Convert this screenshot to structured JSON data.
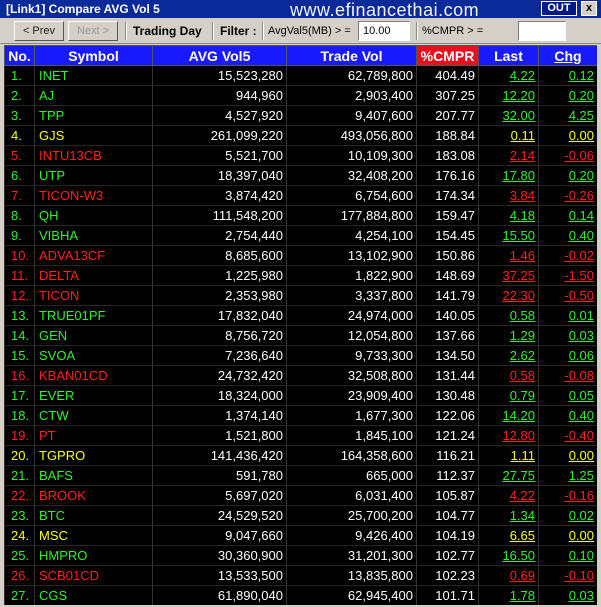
{
  "window": {
    "title": "[Link1] Compare AVG Vol 5",
    "out_label": "OUT",
    "close_label": "x",
    "watermark": "www.efinancethai.com"
  },
  "toolbar": {
    "prev_label": "< Prev",
    "next_label": "Next >",
    "mode_label": "Trading Day",
    "filter_label": "Filter :",
    "avg_filter_label": "AvgVal5(MB) > =",
    "avg_filter_value": "10.00",
    "cmpr_filter_label": "%CMPR > =",
    "cmpr_filter_value": ""
  },
  "table": {
    "headers": {
      "no": "No.",
      "symbol": "Symbol",
      "avg": "AVG Vol5",
      "trade": "Trade Vol",
      "cmpr": "%CMPR",
      "last": "Last",
      "chg": "Chg"
    },
    "colors": {
      "green": "#2ef22e",
      "red": "#ff2020",
      "yellow": "#ffff00",
      "header_blue": "#1a1aff",
      "header_red": "#e8101e"
    },
    "rows": [
      {
        "no": "1.",
        "symbol": "INET",
        "avg": "15,523,280",
        "trade": "62,789,800",
        "cmpr": "404.49",
        "last": "4.22",
        "chg": "0.12",
        "c": "g"
      },
      {
        "no": "2.",
        "symbol": "AJ",
        "avg": "944,960",
        "trade": "2,903,400",
        "cmpr": "307.25",
        "last": "12.20",
        "chg": "0.20",
        "c": "g"
      },
      {
        "no": "3.",
        "symbol": "TPP",
        "avg": "4,527,920",
        "trade": "9,407,600",
        "cmpr": "207.77",
        "last": "32.00",
        "chg": "4.25",
        "c": "g"
      },
      {
        "no": "4.",
        "symbol": "GJS",
        "avg": "261,099,220",
        "trade": "493,056,800",
        "cmpr": "188.84",
        "last": "0.11",
        "chg": "0.00",
        "c": "y"
      },
      {
        "no": "5.",
        "symbol": "INTU13CB",
        "avg": "5,521,700",
        "trade": "10,109,300",
        "cmpr": "183.08",
        "last": "2.14",
        "chg": "-0.06",
        "c": "r"
      },
      {
        "no": "6.",
        "symbol": "UTP",
        "avg": "18,397,040",
        "trade": "32,408,200",
        "cmpr": "176.16",
        "last": "17.80",
        "chg": "0.20",
        "c": "g"
      },
      {
        "no": "7.",
        "symbol": "TICON-W3",
        "avg": "3,874,420",
        "trade": "6,754,600",
        "cmpr": "174.34",
        "last": "3.84",
        "chg": "-0.26",
        "c": "r"
      },
      {
        "no": "8.",
        "symbol": "QH",
        "avg": "111,548,200",
        "trade": "177,884,800",
        "cmpr": "159.47",
        "last": "4.18",
        "chg": "0.14",
        "c": "g"
      },
      {
        "no": "9.",
        "symbol": "VIBHA",
        "avg": "2,754,440",
        "trade": "4,254,100",
        "cmpr": "154.45",
        "last": "15.50",
        "chg": "0.40",
        "c": "g"
      },
      {
        "no": "10.",
        "symbol": "ADVA13CF",
        "avg": "8,685,600",
        "trade": "13,102,900",
        "cmpr": "150.86",
        "last": "1.46",
        "chg": "-0.02",
        "c": "r"
      },
      {
        "no": "11.",
        "symbol": "DELTA",
        "avg": "1,225,980",
        "trade": "1,822,900",
        "cmpr": "148.69",
        "last": "37.25",
        "chg": "-1.50",
        "c": "r"
      },
      {
        "no": "12.",
        "symbol": "TICON",
        "avg": "2,353,980",
        "trade": "3,337,800",
        "cmpr": "141.79",
        "last": "22.30",
        "chg": "-0.50",
        "c": "r"
      },
      {
        "no": "13.",
        "symbol": "TRUE01PF",
        "avg": "17,832,040",
        "trade": "24,974,000",
        "cmpr": "140.05",
        "last": "0.58",
        "chg": "0.01",
        "c": "g"
      },
      {
        "no": "14.",
        "symbol": "GEN",
        "avg": "8,756,720",
        "trade": "12,054,800",
        "cmpr": "137.66",
        "last": "1.29",
        "chg": "0.03",
        "c": "g"
      },
      {
        "no": "15.",
        "symbol": "SVOA",
        "avg": "7,236,640",
        "trade": "9,733,300",
        "cmpr": "134.50",
        "last": "2.62",
        "chg": "0.06",
        "c": "g"
      },
      {
        "no": "16.",
        "symbol": "KBAN01CD",
        "avg": "24,732,420",
        "trade": "32,508,800",
        "cmpr": "131.44",
        "last": "0.58",
        "chg": "-0.08",
        "c": "r"
      },
      {
        "no": "17.",
        "symbol": "EVER",
        "avg": "18,324,000",
        "trade": "23,909,400",
        "cmpr": "130.48",
        "last": "0.79",
        "chg": "0.05",
        "c": "g"
      },
      {
        "no": "18.",
        "symbol": "CTW",
        "avg": "1,374,140",
        "trade": "1,677,300",
        "cmpr": "122.06",
        "last": "14.20",
        "chg": "0.40",
        "c": "g"
      },
      {
        "no": "19.",
        "symbol": "PT",
        "avg": "1,521,800",
        "trade": "1,845,100",
        "cmpr": "121.24",
        "last": "12.80",
        "chg": "-0.40",
        "c": "r"
      },
      {
        "no": "20.",
        "symbol": "TGPRO",
        "avg": "141,436,420",
        "trade": "164,358,600",
        "cmpr": "116.21",
        "last": "1.11",
        "chg": "0.00",
        "c": "y"
      },
      {
        "no": "21.",
        "symbol": "BAFS",
        "avg": "591,780",
        "trade": "665,000",
        "cmpr": "112.37",
        "last": "27.75",
        "chg": "1.25",
        "c": "g"
      },
      {
        "no": "22.",
        "symbol": "BROOK",
        "avg": "5,697,020",
        "trade": "6,031,400",
        "cmpr": "105.87",
        "last": "4.22",
        "chg": "-0.16",
        "c": "r"
      },
      {
        "no": "23.",
        "symbol": "BTC",
        "avg": "24,529,520",
        "trade": "25,700,200",
        "cmpr": "104.77",
        "last": "1.34",
        "chg": "0.02",
        "c": "g"
      },
      {
        "no": "24.",
        "symbol": "MSC",
        "avg": "9,047,660",
        "trade": "9,426,400",
        "cmpr": "104.19",
        "last": "6.65",
        "chg": "0.00",
        "c": "y"
      },
      {
        "no": "25.",
        "symbol": "HMPRO",
        "avg": "30,360,900",
        "trade": "31,201,300",
        "cmpr": "102.77",
        "last": "16.50",
        "chg": "0.10",
        "c": "g"
      },
      {
        "no": "26.",
        "symbol": "SCB01CD",
        "avg": "13,533,500",
        "trade": "13,835,800",
        "cmpr": "102.23",
        "last": "0.69",
        "chg": "-0.10",
        "c": "r"
      },
      {
        "no": "27.",
        "symbol": "CGS",
        "avg": "61,890,040",
        "trade": "62,945,400",
        "cmpr": "101.71",
        "last": "1.78",
        "chg": "0.03",
        "c": "g"
      }
    ]
  }
}
